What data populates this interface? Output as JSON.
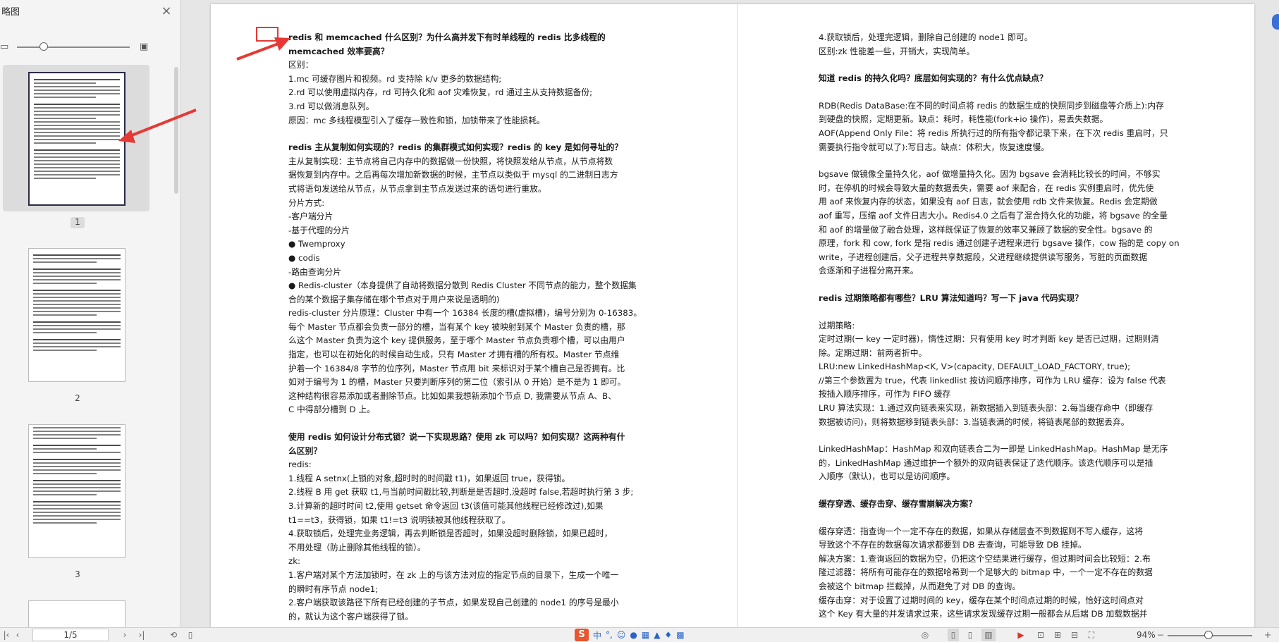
{
  "sidebar": {
    "title": "略图",
    "close_glyph": "×",
    "thumbnails": [
      {
        "number": "1",
        "selected": true
      },
      {
        "number": "2",
        "selected": false
      },
      {
        "number": "3",
        "selected": false
      }
    ]
  },
  "statusbar": {
    "page_indicator": "1/5",
    "zoom": "94%",
    "ime_logo": "S",
    "ime_lang": "中"
  },
  "colors": {
    "annotation": "#e53935",
    "accent": "#3a6ed8"
  },
  "left_column": [
    {
      "t": "redis 和 memcached 什么区别？为什么高并发下有时单线程的 redis 比多线程的",
      "h": true
    },
    {
      "t": "memcached 效率要高？",
      "h": true
    },
    {
      "t": "区别："
    },
    {
      "t": "1.mc 可缓存图片和视频。rd 支持除 k/v 更多的数据结构;"
    },
    {
      "t": "2.rd 可以使用虚拟内存，rd 可持久化和 aof 灾难恢复，rd 通过主从支持数据备份;"
    },
    {
      "t": "3.rd 可以做消息队列。"
    },
    {
      "t": "原因：mc 多线程模型引入了缓存一致性和锁，加锁带来了性能损耗。"
    },
    {
      "t": ""
    },
    {
      "t": "redis 主从复制如何实现的？redis 的集群模式如何实现？redis 的 key 是如何寻址的？",
      "h": true
    },
    {
      "t": "主从复制实现：主节点将自己内存中的数据做一份快照，将快照发给从节点，从节点将数"
    },
    {
      "t": "据恢复到内存中。之后再每次增加新数据的时候，主节点以类似于 mysql 的二进制日志方"
    },
    {
      "t": "式将语句发送给从节点，从节点拿到主节点发送过来的语句进行重放。"
    },
    {
      "t": "分片方式:"
    },
    {
      "t": "-客户端分片"
    },
    {
      "t": "-基于代理的分片"
    },
    {
      "t": "●  Twemproxy"
    },
    {
      "t": "●  codis"
    },
    {
      "t": "-路由查询分片"
    },
    {
      "t": "●  Redis-cluster（本身提供了自动将数据分散到 Redis Cluster 不同节点的能力，整个数据集"
    },
    {
      "t": "合的某个数据子集存储在哪个节点对于用户来说是透明的)"
    },
    {
      "t": "redis-cluster 分片原理：Cluster 中有一个 16384 长度的槽(虚拟槽)，编号分别为 0-16383。"
    },
    {
      "t": "每个 Master 节点都会负责一部分的槽，当有某个 key 被映射到某个 Master 负责的槽，那"
    },
    {
      "t": "么这个 Master 负责为这个 key 提供服务，至于哪个 Master 节点负责哪个槽，可以由用户"
    },
    {
      "t": "指定，也可以在初始化的时候自动生成，只有 Master 才拥有槽的所有权。Master 节点维"
    },
    {
      "t": "护着一个 16384/8 字节的位序列，Master 节点用 bit 来标识对于某个槽自己是否拥有。比"
    },
    {
      "t": "如对于编号为 1 的槽，Master 只要判断序列的第二位（索引从 0 开始）是不是为 1 即可。"
    },
    {
      "t": "这种结构很容易添加或者删除节点。比如如果我想新添加个节点 D,   我需要从节点 A、B、"
    },
    {
      "t": "C 中得部分槽到 D 上。"
    },
    {
      "t": ""
    },
    {
      "t": "使用 redis 如何设计分布式锁？说一下实现思路？使用 zk 可以吗？如何实现？这两种有什",
      "h": true
    },
    {
      "t": "么区别？",
      "h": true
    },
    {
      "t": "redis:"
    },
    {
      "t": "1.线程 A setnx(上锁的对象,超时时的时间戳 t1)，如果返回 true，获得锁。"
    },
    {
      "t": "2.线程 B  用 get 获取 t1,与当前时间戳比较,判断是是否超时,没超时 false,若超时执行第 3 步;"
    },
    {
      "t": "3.计算新的超时时间 t2,使用 getset 命令返回 t3(该值可能其他线程已经修改过),如果"
    },
    {
      "t": "t1==t3，获得锁，如果 t1!=t3 说明锁被其他线程获取了。"
    },
    {
      "t": "4.获取锁后，处理完业务逻辑，再去判断锁是否超时，如果没超时删除锁，如果已超时，"
    },
    {
      "t": "不用处理（防止删除其他线程的锁）。"
    },
    {
      "t": "zk:"
    },
    {
      "t": "1.客户端对某个方法加锁时，在 zk 上的与该方法对应的指定节点的目录下，生成一个唯一"
    },
    {
      "t": "的瞬时有序节点 node1;"
    },
    {
      "t": "2.客户端获取该路径下所有已经创建的子节点，如果发现自己创建的 node1 的序号是最小"
    },
    {
      "t": "的，就认为这个客户端获得了锁。"
    }
  ],
  "right_column": [
    {
      "t": "4.获取锁后，处理完逻辑，删除自己创建的 node1 即可。"
    },
    {
      "t": "区别:zk 性能差一些，开销大，实现简单。"
    },
    {
      "t": ""
    },
    {
      "t": "知道 redis 的持久化吗？底层如何实现的？有什么优点缺点？",
      "h": true
    },
    {
      "t": ""
    },
    {
      "t": "RDB(Redis   DataBase:在不同的时间点将 redis 的数据生成的快照同步到磁盘等介质上):内存"
    },
    {
      "t": "到硬盘的快照，定期更新。缺点：耗时，耗性能(fork+io 操作)，易丢失数据。"
    },
    {
      "t": "AOF(Append  Only  File：将 redis 所执行过的所有指令都记录下来，在下次 redis 重启时，只"
    },
    {
      "t": "需要执行指令就可以了):写日志。缺点：体积大，恢复速度慢。"
    },
    {
      "t": ""
    },
    {
      "t": "bgsave 做镜像全量持久化，aof 做增量持久化。因为 bgsave 会消耗比较长的时间，不够实"
    },
    {
      "t": "时，在停机的时候会导致大量的数据丢失，需要 aof 来配合，在 redis 实例重启时，优先使"
    },
    {
      "t": "用 aof 来恢复内存的状态，如果没有 aof 日志，就会使用 rdb 文件来恢复。Redis 会定期做"
    },
    {
      "t": "aof 重写，压缩 aof 文件日志大小。Redis4.0 之后有了混合持久化的功能，将 bgsave 的全量"
    },
    {
      "t": "和 aof 的增量做了融合处理，这样既保证了恢复的效率又兼顾了数据的安全性。bgsave 的"
    },
    {
      "t": "原理，fork 和 cow, fork 是指 redis 通过创建子进程来进行 bgsave 操作，cow 指的是 copy on"
    },
    {
      "t": "write，子进程创建后，父子进程共享数据段，父进程继续提供读写服务，写脏的页面数据"
    },
    {
      "t": "会逐渐和子进程分离开来。"
    },
    {
      "t": ""
    },
    {
      "t": "redis 过期策略都有哪些？LRU 算法知道吗？写一下 java 代码实现？",
      "h": true
    },
    {
      "t": ""
    },
    {
      "t": "过期策略:"
    },
    {
      "t": "定时过期(一 key 一定时器)，惰性过期：只有使用 key 时才判断 key 是否已过期，过期则清"
    },
    {
      "t": "除。定期过期：前两者折中。"
    },
    {
      "t": "LRU:new LinkedHashMap<K, V>(capacity, DEFAULT_LOAD_FACTORY, true);"
    },
    {
      "t": "//第三个参数置为 true，代表 linkedlist 按访问顺序排序，可作为 LRU 缓存：设为 false 代表"
    },
    {
      "t": "按插入顺序排序，可作为 FIFO 缓存"
    },
    {
      "t": "LRU 算法实现：1.通过双向链表来实现，新数据插入到链表头部：2.每当缓存命中（即缓存"
    },
    {
      "t": "数据被访问)，则将数据移到链表头部：3.当链表满的时候，将链表尾部的数据丢弃。"
    },
    {
      "t": ""
    },
    {
      "t": "LinkedHashMap：HashMap 和双向链表合二为一即是 LinkedHashMap。HashMap 是无序"
    },
    {
      "t": "的，LinkedHashMap 通过维护一个额外的双向链表保证了迭代顺序。该迭代顺序可以是插"
    },
    {
      "t": "入顺序（默认)，也可以是访问顺序。"
    },
    {
      "t": ""
    },
    {
      "t": "缓存穿透、缓存击穿、缓存雪崩解决方案？",
      "h": true
    },
    {
      "t": ""
    },
    {
      "t": "缓存穿透：指查询一个一定不存在的数据，如果从存储层查不到数据则不写入缓存，这将"
    },
    {
      "t": "导致这个不存在的数据每次请求都要到 DB 去查询，可能导致 DB 挂掉。"
    },
    {
      "t": "解决方案：1.查询返回的数据为空，仍把这个空结果进行缓存，但过期时间会比较短：2.布"
    },
    {
      "t": "隆过滤器：将所有可能存在的数据哈希到一个足够大的 bitmap 中，一个一定不存在的数据"
    },
    {
      "t": "会被这个 bitmap 拦截掉，从而避免了对 DB 的查询。"
    },
    {
      "t": "缓存击穿：对于设置了过期时间的 key，缓存在某个时间点过期的时候，恰好这时间点对"
    },
    {
      "t": "这个 Key 有大量的并发请求过来，这些请求发现缓存过期一般都会从后端 DB 加载数据并"
    }
  ]
}
